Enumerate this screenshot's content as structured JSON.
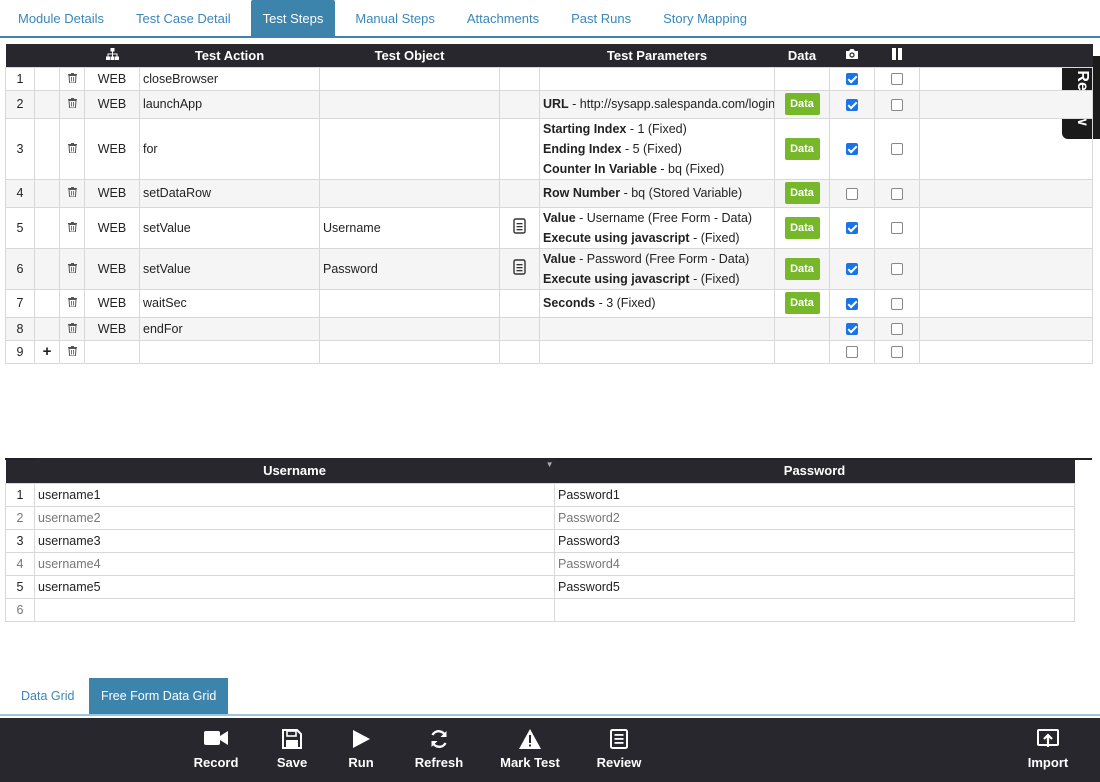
{
  "tabs": [
    "Module Details",
    "Test Case Detail",
    "Test Steps",
    "Manual Steps",
    "Attachments",
    "Past Runs",
    "Story Mapping"
  ],
  "active_tab": "Test Steps",
  "review_label": "Review",
  "steps_table": {
    "headers": {
      "hierarchy_icon": "sitemap-icon",
      "action": "Test Action",
      "object": "Test Object",
      "params": "Test Parameters",
      "data": "Data",
      "camera_icon": "camera-icon",
      "pause_icon": "pause-icon"
    },
    "data_button_label": "Data",
    "rows": [
      {
        "num": "1",
        "platform": "WEB",
        "action": "closeBrowser",
        "object": "",
        "params": [],
        "has_data": false,
        "screenshot": true,
        "pause": false
      },
      {
        "num": "2",
        "platform": "WEB",
        "action": "launchApp",
        "object": "",
        "params": [
          {
            "k": "URL",
            "v": " - http://sysapp.salespanda.com/login.php"
          }
        ],
        "has_data": true,
        "screenshot": true,
        "pause": false
      },
      {
        "num": "3",
        "platform": "WEB",
        "action": "for",
        "object": "",
        "params": [
          {
            "k": "Starting Index",
            "v": " - 1 (Fixed)"
          },
          {
            "k": "Ending Index",
            "v": " - 5 (Fixed)"
          },
          {
            "k": "Counter In Variable",
            "v": " - bq (Fixed)"
          }
        ],
        "has_data": true,
        "screenshot": true,
        "pause": false
      },
      {
        "num": "4",
        "platform": "WEB",
        "action": "setDataRow",
        "object": "",
        "params": [
          {
            "k": "Row Number",
            "v": " - bq (Stored Variable)"
          }
        ],
        "has_data": true,
        "screenshot": false,
        "pause": false
      },
      {
        "num": "5",
        "platform": "WEB",
        "action": "setValue",
        "object": "Username",
        "has_object_icon": true,
        "params": [
          {
            "k": "Value",
            "v": " - Username (Free Form - Data)"
          },
          {
            "k": "Execute using javascript",
            "v": " -   (Fixed)"
          }
        ],
        "has_data": true,
        "screenshot": true,
        "pause": false
      },
      {
        "num": "6",
        "platform": "WEB",
        "action": "setValue",
        "object": "Password",
        "has_object_icon": true,
        "params": [
          {
            "k": "Value",
            "v": " - Password (Free Form - Data)"
          },
          {
            "k": "Execute using javascript",
            "v": " -   (Fixed)"
          }
        ],
        "has_data": true,
        "screenshot": true,
        "pause": false
      },
      {
        "num": "7",
        "platform": "WEB",
        "action": "waitSec",
        "object": "",
        "params": [
          {
            "k": "Seconds",
            "v": " - 3 (Fixed)"
          }
        ],
        "has_data": true,
        "screenshot": true,
        "pause": false
      },
      {
        "num": "8",
        "platform": "WEB",
        "action": "endFor",
        "object": "",
        "params": [],
        "has_data": false,
        "screenshot": true,
        "pause": false
      },
      {
        "num": "9",
        "platform": "",
        "action": "",
        "object": "",
        "params": [],
        "has_data": false,
        "screenshot": false,
        "pause": false,
        "add_row": true
      }
    ]
  },
  "data_grid": {
    "headers": [
      "Username",
      "Password"
    ],
    "rows": [
      {
        "num": "1",
        "username": "username1",
        "password": "Password1"
      },
      {
        "num": "2",
        "username": "username2",
        "password": "Password2"
      },
      {
        "num": "3",
        "username": "username3",
        "password": "Password3"
      },
      {
        "num": "4",
        "username": "username4",
        "password": "Password4"
      },
      {
        "num": "5",
        "username": "username5",
        "password": "Password5"
      },
      {
        "num": "6",
        "username": "",
        "password": ""
      }
    ]
  },
  "bottom_tabs": [
    "Data Grid",
    "Free Form Data Grid"
  ],
  "bottom_active": "Free Form Data Grid",
  "toolbar": [
    {
      "label": "Record",
      "icon": "video-camera-icon"
    },
    {
      "label": "Save",
      "icon": "floppy-disk-icon"
    },
    {
      "label": "Run",
      "icon": "play-icon"
    },
    {
      "label": "Refresh",
      "icon": "refresh-icon"
    },
    {
      "label": "Mark Test",
      "icon": "warning-icon"
    },
    {
      "label": "Review",
      "icon": "document-icon"
    },
    {
      "label": "Import",
      "icon": "import-icon"
    }
  ],
  "colors": {
    "accent": "#3d84ad",
    "header": "#27272d",
    "data_button": "#76b82a",
    "checkbox": "#1a73e8"
  }
}
